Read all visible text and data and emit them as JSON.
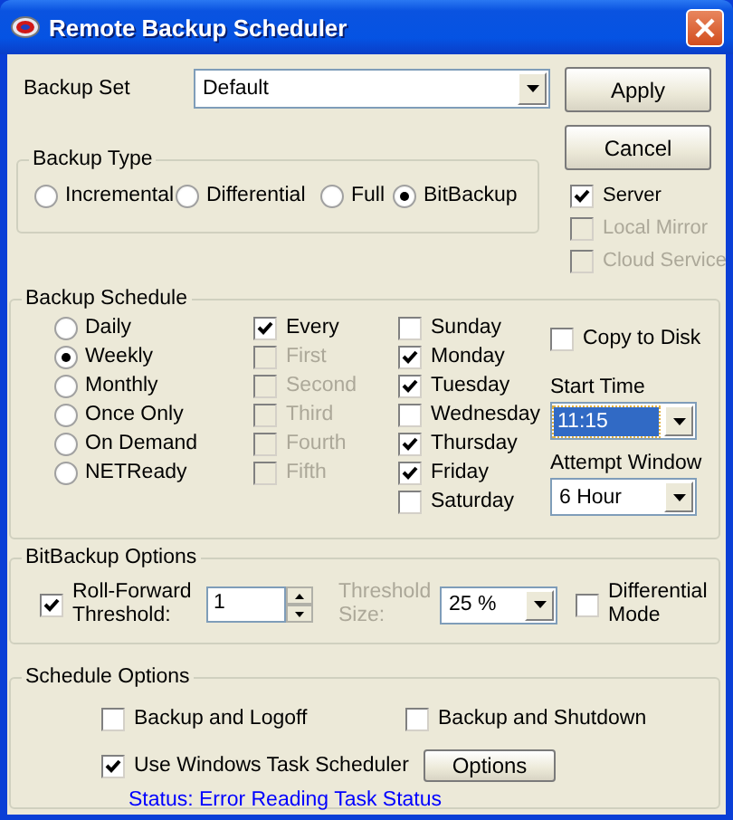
{
  "window": {
    "title": "Remote Backup Scheduler"
  },
  "backup_set": {
    "label": "Backup Set",
    "value": "Default"
  },
  "buttons": [
    {
      "label": "Apply"
    },
    {
      "label": "Cancel"
    }
  ],
  "destinations": [
    {
      "label": "Server",
      "checked": true,
      "disabled": false
    },
    {
      "label": "Local Mirror",
      "checked": false,
      "disabled": true
    },
    {
      "label": "Cloud Service",
      "checked": false,
      "disabled": true
    }
  ],
  "backup_type": {
    "title": "Backup Type",
    "options": [
      {
        "label": "Incremental",
        "selected": false
      },
      {
        "label": "Differential",
        "selected": false
      },
      {
        "label": "Full",
        "selected": false
      },
      {
        "label": "BitBackup",
        "selected": true
      }
    ]
  },
  "backup_schedule": {
    "title": "Backup Schedule",
    "frequencies": [
      {
        "label": "Daily",
        "selected": false
      },
      {
        "label": "Weekly",
        "selected": true
      },
      {
        "label": "Monthly",
        "selected": false
      },
      {
        "label": "Once Only",
        "selected": false
      },
      {
        "label": "On Demand",
        "selected": false
      },
      {
        "label": "NETReady",
        "selected": false
      }
    ],
    "occurrences": [
      {
        "label": "Every",
        "checked": true,
        "disabled": false
      },
      {
        "label": "First",
        "checked": false,
        "disabled": true
      },
      {
        "label": "Second",
        "checked": false,
        "disabled": true
      },
      {
        "label": "Third",
        "checked": false,
        "disabled": true
      },
      {
        "label": "Fourth",
        "checked": false,
        "disabled": true
      },
      {
        "label": "Fifth",
        "checked": false,
        "disabled": true
      }
    ],
    "days": [
      {
        "label": "Sunday",
        "checked": false
      },
      {
        "label": "Monday",
        "checked": true
      },
      {
        "label": "Tuesday",
        "checked": true
      },
      {
        "label": "Wednesday",
        "checked": false
      },
      {
        "label": "Thursday",
        "checked": true
      },
      {
        "label": "Friday",
        "checked": true
      },
      {
        "label": "Saturday",
        "checked": false
      }
    ],
    "copy_to_disk": {
      "label": "Copy to Disk",
      "checked": false
    },
    "start_time": {
      "label": "Start Time",
      "value": "11:15",
      "focused": true
    },
    "attempt_window": {
      "label": "Attempt Window",
      "value": "6 Hour",
      "focused": false
    }
  },
  "bitbackup_options": {
    "title": "BitBackup Options",
    "roll_forward": {
      "label": "Roll-Forward Threshold:",
      "checked": true,
      "value": "1"
    },
    "threshold_size": {
      "label": "Threshold Size:",
      "disabled": true,
      "value": "25 %"
    },
    "differential_mode": {
      "label": "Differential Mode",
      "checked": false
    }
  },
  "schedule_options": {
    "title": "Schedule Options",
    "checkboxes": [
      {
        "label": "Backup and Logoff",
        "checked": false
      },
      {
        "label": "Backup and Shutdown",
        "checked": false
      },
      {
        "label": "Use Windows Task Scheduler",
        "checked": true
      }
    ],
    "options_button": "Options",
    "status": "Status: Error Reading Task Status"
  }
}
